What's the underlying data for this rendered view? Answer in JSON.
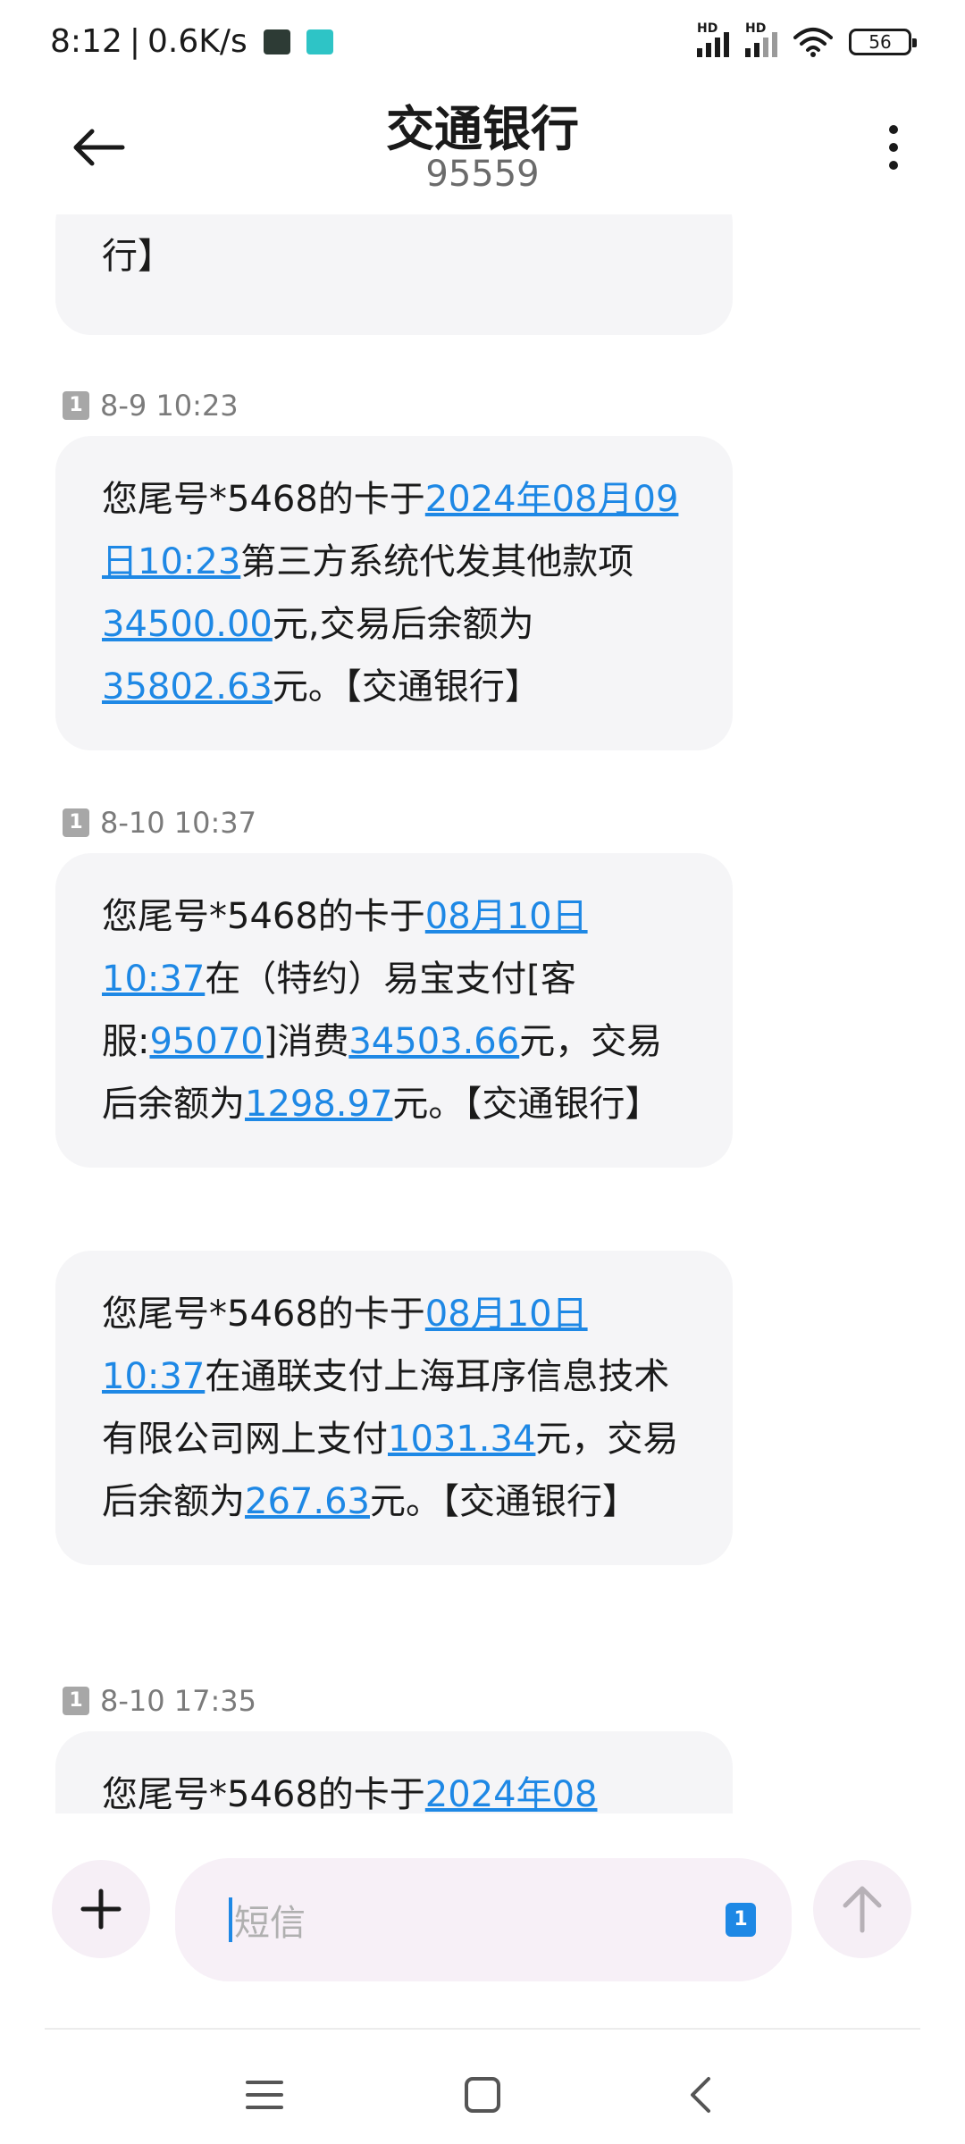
{
  "status_bar": {
    "time": "8:12",
    "separator": "|",
    "net_speed": "0.6K/s",
    "hd_label_1": "HD",
    "hd_label_2": "HD",
    "battery": "56"
  },
  "header": {
    "title": "交通银行",
    "subtitle": "95559"
  },
  "messages": [
    {
      "segments": [
        {
          "text": "行】",
          "link": false
        }
      ]
    },
    {
      "sim": "1",
      "timestamp": "8-9 10:23",
      "segments": [
        {
          "text": "您尾号*5468的卡于",
          "link": false
        },
        {
          "text": "2024年08月09日10:23",
          "link": true
        },
        {
          "text": "第三方系统代发其他款项",
          "link": false
        },
        {
          "text": "34500.00",
          "link": true
        },
        {
          "text": "元,交易后余额为",
          "link": false
        },
        {
          "text": "35802.63",
          "link": true
        },
        {
          "text": "元。【交通银行】",
          "link": false
        }
      ]
    },
    {
      "sim": "1",
      "timestamp": "8-10 10:37",
      "segments": [
        {
          "text": "您尾号*5468的卡于",
          "link": false
        },
        {
          "text": "08月10日10:37",
          "link": true
        },
        {
          "text": "在（特约）易宝支付[客服:",
          "link": false
        },
        {
          "text": "95070",
          "link": true
        },
        {
          "text": "]消费",
          "link": false
        },
        {
          "text": "34503.66",
          "link": true
        },
        {
          "text": "元，交易后余额为",
          "link": false
        },
        {
          "text": "1298.97",
          "link": true
        },
        {
          "text": "元。【交通银行】",
          "link": false
        }
      ]
    },
    {
      "segments": [
        {
          "text": "您尾号*5468的卡于",
          "link": false
        },
        {
          "text": "08月10日10:37",
          "link": true
        },
        {
          "text": "在通联支付上海耳序信息技术有限公司网上支付",
          "link": false
        },
        {
          "text": "1031.34",
          "link": true
        },
        {
          "text": "元，交易后余额为",
          "link": false
        },
        {
          "text": "267.63",
          "link": true
        },
        {
          "text": "元。【交通银行】",
          "link": false
        }
      ]
    },
    {
      "sim": "1",
      "timestamp": "8-10 17:35",
      "segments": [
        {
          "text": "您尾号*5468的卡于",
          "link": false
        },
        {
          "text": "2024年08",
          "link": true
        }
      ]
    }
  ],
  "composer": {
    "placeholder": "短信",
    "sim_badge": "1"
  },
  "icons": {
    "back": "back-arrow-icon",
    "more": "more-vertical-icon",
    "add": "plus-icon",
    "send": "arrow-up-icon",
    "nav_menu": "menu-icon",
    "nav_home": "home-square-icon",
    "nav_back": "chevron-left-icon"
  },
  "colors": {
    "link": "#1e88e5",
    "bubble": "#f5f5f7",
    "composer": "#f7f0f7"
  }
}
